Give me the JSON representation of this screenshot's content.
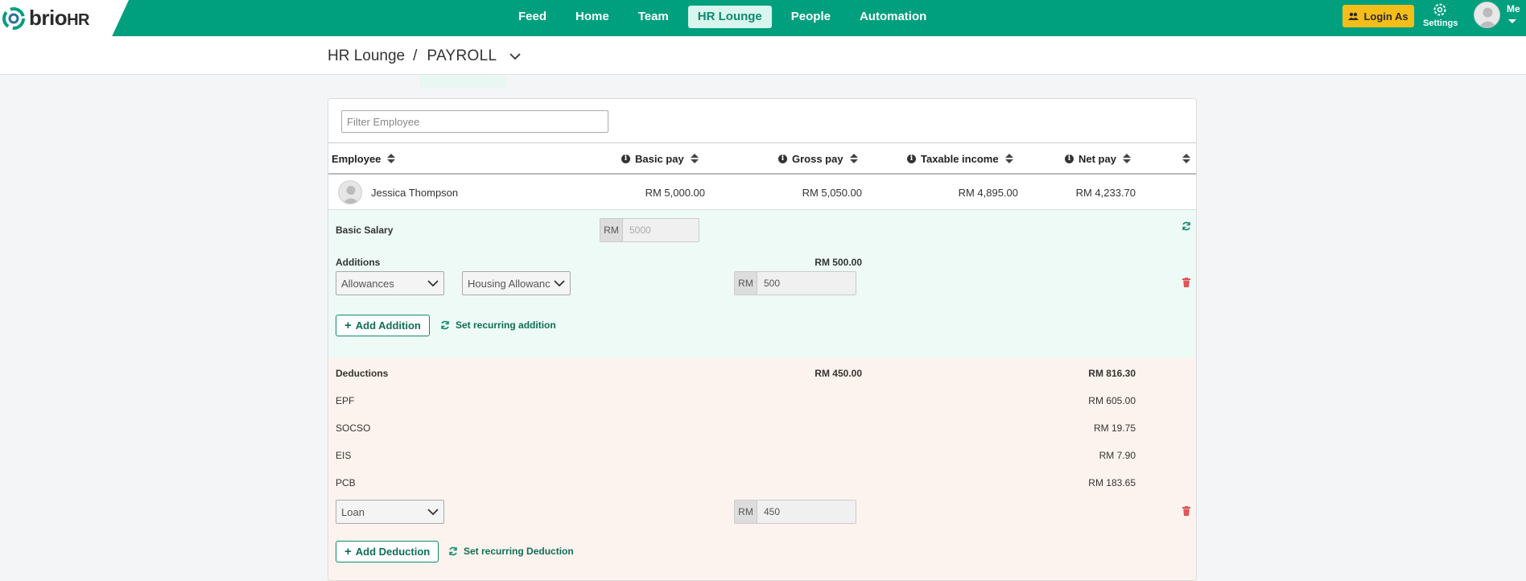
{
  "brand": {
    "name_main": "brio",
    "name_suffix": "HR"
  },
  "nav": {
    "items": [
      "Feed",
      "Home",
      "Team",
      "HR Lounge",
      "People",
      "Automation"
    ],
    "active_index": 3,
    "login_as": "Login As",
    "settings": "Settings",
    "me": "Me"
  },
  "colors": {
    "primary": "#00a07e",
    "accent_yellow": "#f5bd1a",
    "addition_bg": "#eefaf6",
    "deduction_bg": "#fdf3ee",
    "danger": "#e05555"
  },
  "breadcrumb": {
    "parent": "HR Lounge",
    "separator": "/",
    "current": "PAYROLL"
  },
  "filter": {
    "placeholder": "Filter Employee",
    "value": ""
  },
  "table": {
    "headers": {
      "employee": "Employee",
      "basic_pay": "Basic pay",
      "gross_pay": "Gross pay",
      "taxable_income": "Taxable income",
      "net_pay": "Net pay"
    },
    "row": {
      "name": "Jessica Thompson",
      "basic_pay": "RM 5,000.00",
      "gross_pay": "RM 5,050.00",
      "taxable_income": "RM 4,895.00",
      "net_pay": "RM 4,233.70"
    }
  },
  "basic_salary": {
    "label": "Basic Salary",
    "currency": "RM",
    "value": "5000"
  },
  "additions": {
    "label": "Additions",
    "total": "RM 500.00",
    "item": {
      "category": "Allowances",
      "type": "Housing Allowanc",
      "currency": "RM",
      "amount": "500"
    },
    "add_button": "Add Addition",
    "recurring_link": "Set recurring addition"
  },
  "deductions": {
    "label": "Deductions",
    "total": "RM 450.00",
    "statutory_total": "RM 816.30",
    "statutory": [
      {
        "name": "EPF",
        "amount": "RM 605.00"
      },
      {
        "name": "SOCSO",
        "amount": "RM 19.75"
      },
      {
        "name": "EIS",
        "amount": "RM 7.90"
      },
      {
        "name": "PCB",
        "amount": "RM 183.65"
      }
    ],
    "item": {
      "category": "Loan",
      "currency": "RM",
      "amount": "450"
    },
    "add_button": "Add Deduction",
    "recurring_link": "Set recurring Deduction"
  }
}
